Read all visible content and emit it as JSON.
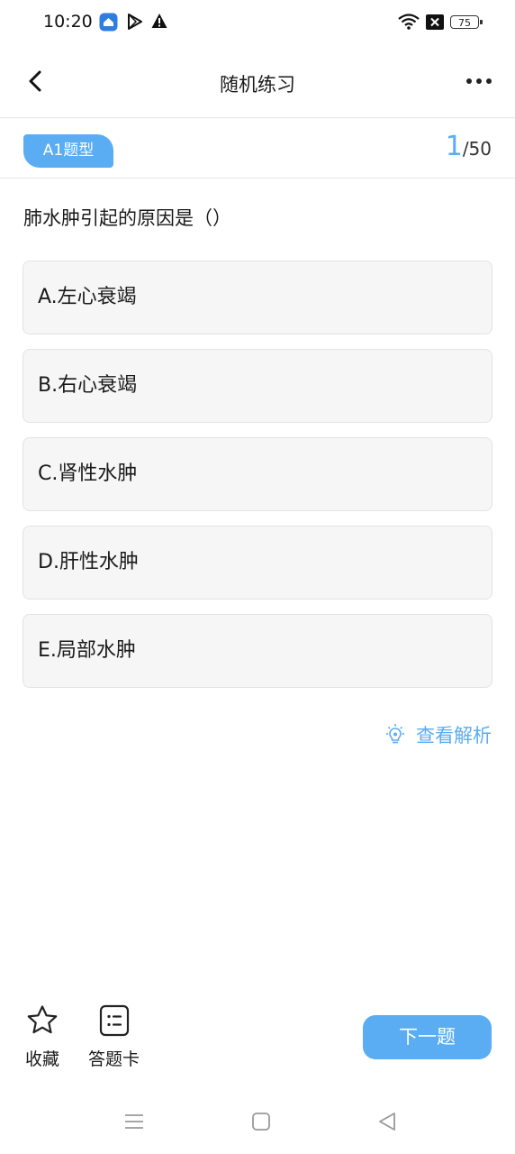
{
  "status_bar": {
    "time": "10:20",
    "battery": "75",
    "icons": [
      "app-notification-icon",
      "play-store-icon",
      "warning-icon",
      "wifi-icon",
      "no-sim-icon",
      "battery-icon"
    ]
  },
  "nav": {
    "title": "随机练习",
    "back_icon": "chevron-left-icon",
    "more_icon": "more-dots-icon"
  },
  "question": {
    "type_tag": "A1题型",
    "current": "1",
    "total": "/50",
    "text": "肺水肿引起的原因是（）",
    "options": [
      "A.左心衰竭",
      "B.右心衰竭",
      "C.肾性水肿",
      "D.肝性水肿",
      "E.局部水肿"
    ],
    "analysis_label": "查看解析"
  },
  "toolbar": {
    "favorite_label": "收藏",
    "answer_card_label": "答题卡",
    "next_label": "下一题"
  },
  "colors": {
    "accent": "#5aacf3",
    "option_bg": "#f6f6f6"
  }
}
